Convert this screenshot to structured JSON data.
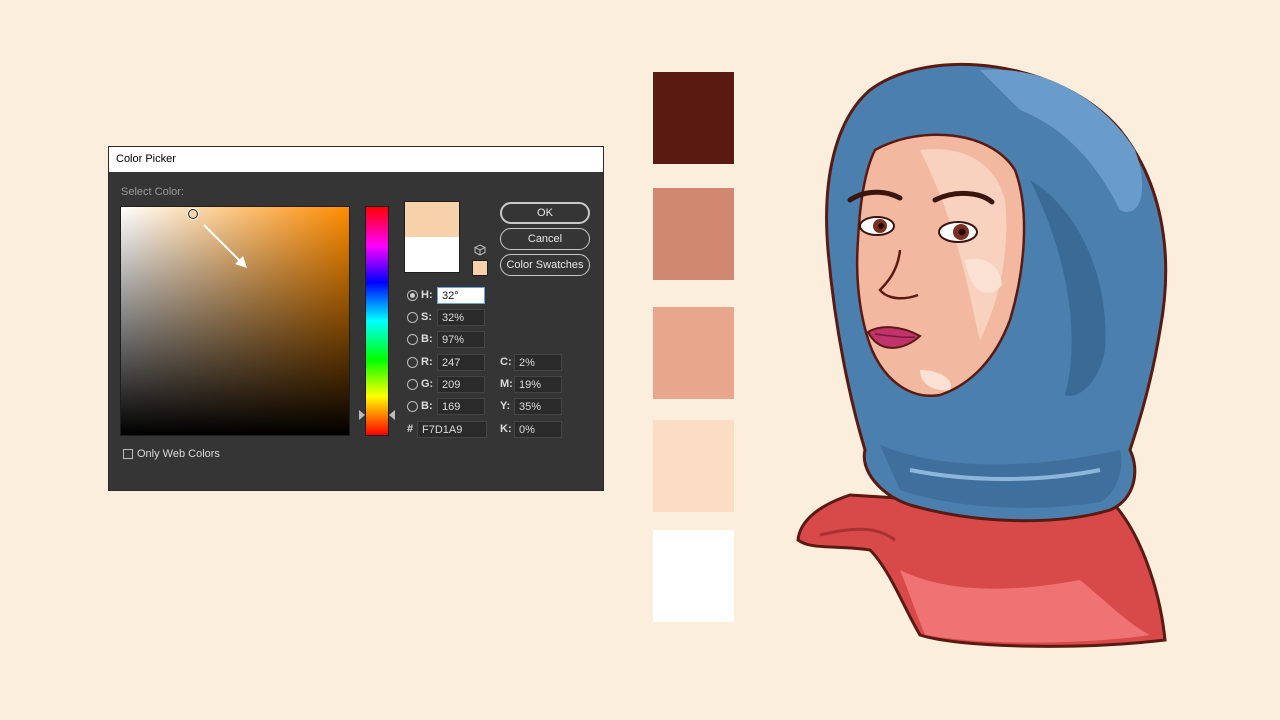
{
  "dialog": {
    "title": "Color Picker",
    "select_label": "Select Color:",
    "buttons": {
      "ok": "OK",
      "cancel": "Cancel",
      "swatches": "Color Swatches"
    },
    "fields": {
      "h": {
        "label": "H:",
        "value": "32°"
      },
      "s": {
        "label": "S:",
        "value": "32%"
      },
      "b": {
        "label": "B:",
        "value": "97%"
      },
      "r": {
        "label": "R:",
        "value": "247"
      },
      "g": {
        "label": "G:",
        "value": "209"
      },
      "bl": {
        "label": "B:",
        "value": "169"
      },
      "hex": {
        "label": "#",
        "value": "F7D1A9"
      },
      "c": {
        "label": "C:",
        "value": "2%"
      },
      "m": {
        "label": "M:",
        "value": "19%"
      },
      "y": {
        "label": "Y:",
        "value": "35%"
      },
      "k": {
        "label": "K:",
        "value": "0%"
      }
    },
    "only_web_colors": "Only Web Colors",
    "new_color": "#f7d1a9",
    "current_color": "#ffffff"
  },
  "swatches": [
    "#5a1a12",
    "#d08870",
    "#e8a68c",
    "#fbdcc4",
    "#ffffff"
  ],
  "colors": {
    "background": "#fbeedc",
    "hijab_blue": "#4a7fae",
    "scarf_red": "#d84a4a",
    "skin": "#f2b9a0",
    "outline": "#5a1a12"
  }
}
